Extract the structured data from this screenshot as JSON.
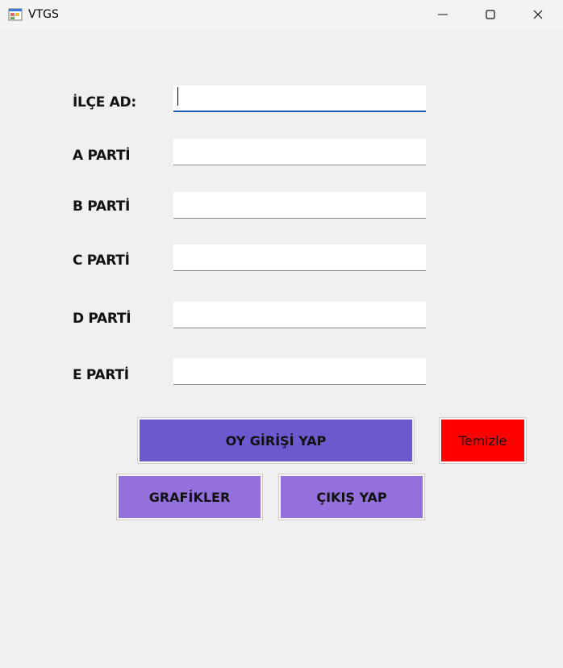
{
  "window": {
    "title": "VTGS",
    "icon": "winforms-app-icon",
    "controls": [
      "minimize-icon",
      "maximize-icon",
      "close-icon"
    ]
  },
  "form": {
    "fields": [
      {
        "label": "İLÇE AD:",
        "value": "",
        "focused": true
      },
      {
        "label": "A PARTİ",
        "value": ""
      },
      {
        "label": "B PARTİ",
        "value": ""
      },
      {
        "label": "C PARTİ",
        "value": ""
      },
      {
        "label": "D PARTİ",
        "value": ""
      },
      {
        "label": "E PARTİ",
        "value": ""
      }
    ]
  },
  "buttons": {
    "oy_girisi": "OY GİRİŞİ YAP",
    "temizle": "Temizle",
    "grafikler": "GRAFİKLER",
    "cikis": "ÇIKIŞ YAP"
  },
  "colors": {
    "oy_girisi_bg": "#6a5acd",
    "temizle_bg": "#ff0000",
    "secondary_bg": "#9370db",
    "focus_underline": "#1a5fb4"
  }
}
